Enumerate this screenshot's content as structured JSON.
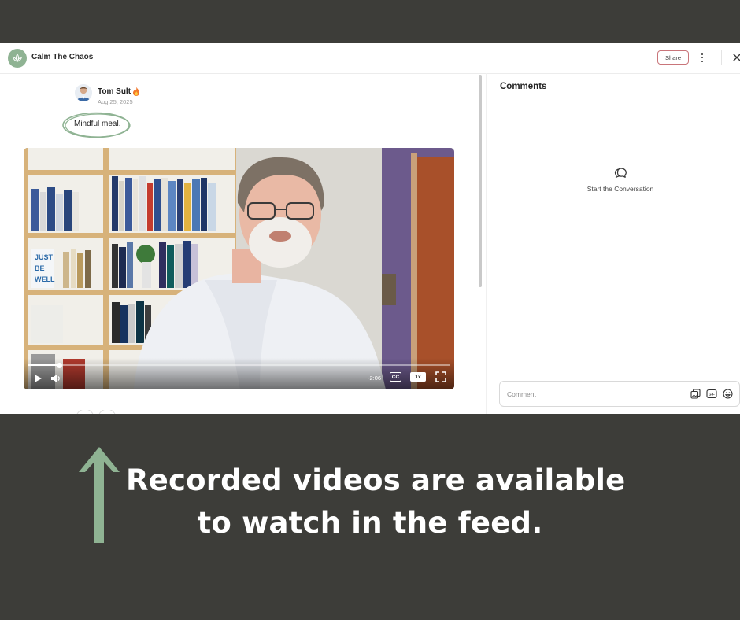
{
  "app": {
    "name": "Calm The Chaos",
    "logo_icon": "lotus-icon",
    "share_label": "Share",
    "more_icon": "kebab-menu-icon",
    "close_icon": "close-icon"
  },
  "post": {
    "author": "Tom Sult",
    "author_badge_icon": "fire-icon",
    "date": "Aug 25, 2025",
    "text": "Mindful meal."
  },
  "video": {
    "time_remaining": "-2:06",
    "progress_fraction": 0.075,
    "cc_label": "CC",
    "speed_label": "1x",
    "play_icon": "play-icon",
    "volume_icon": "volume-icon",
    "fullscreen_icon": "fullscreen-icon"
  },
  "comments": {
    "title": "Comments",
    "empty_icon": "chat-bubbles-icon",
    "empty_text": "Start the Conversation",
    "input_placeholder": "Comment",
    "action_icons": [
      "image-icon",
      "gif-icon",
      "emoji-icon"
    ],
    "gif_label": "GIF"
  },
  "banner": {
    "line1": "Recorded videos are available",
    "line2": "to watch in the feed.",
    "arrow_color": "#8fb393",
    "text_color": "#ffffff",
    "background_color": "#3d3d39"
  },
  "colors": {
    "accent": "#8fb393",
    "share_border": "#c9757a"
  }
}
